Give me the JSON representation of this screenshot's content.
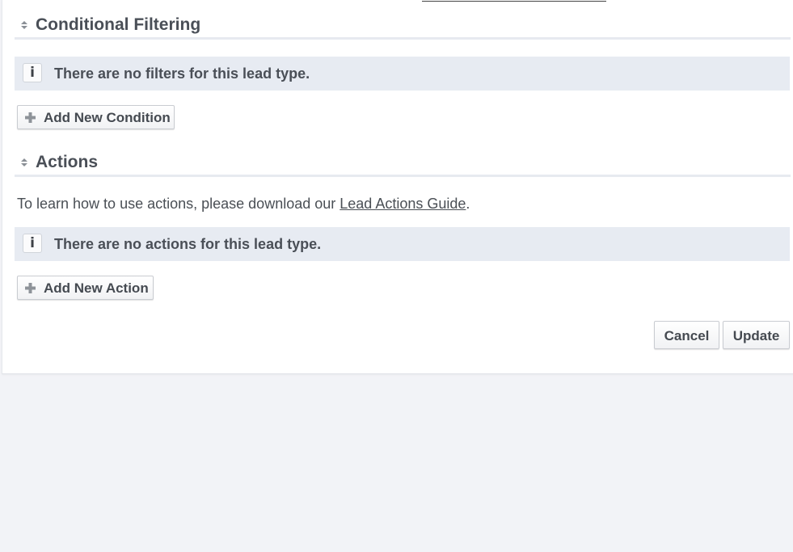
{
  "conditional_filtering": {
    "title": "Conditional Filtering",
    "info_icon": "i",
    "info_text": "There are no filters for this lead type.",
    "add_button": {
      "label": "Add New Condition",
      "icon": "plus-icon"
    }
  },
  "actions": {
    "title": "Actions",
    "help_prefix": "To learn how to use actions, please download our ",
    "help_link": "Lead Actions Guide",
    "help_suffix": ".",
    "info_icon": "i",
    "info_text": "There are no actions for this lead type.",
    "add_button": {
      "label": "Add New Action",
      "icon": "plus-icon"
    }
  },
  "footer": {
    "cancel_label": "Cancel",
    "update_label": "Update"
  },
  "colors": {
    "page_background": "#f2f3f7",
    "panel_background": "#ffffff",
    "info_bar": "#e7ebf2",
    "text": "#4a4f55"
  }
}
